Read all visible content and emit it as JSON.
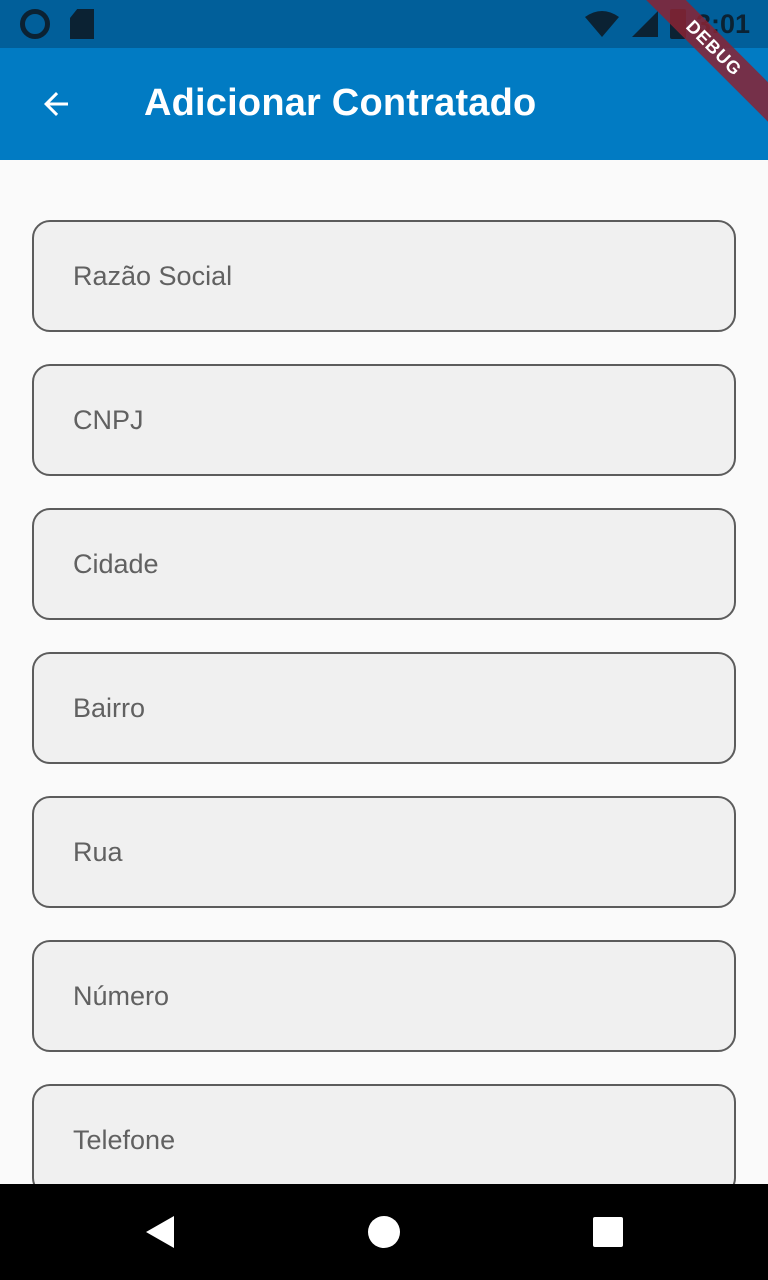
{
  "status_bar": {
    "time": "3:01",
    "icons": [
      "circle-icon",
      "sd-card-icon",
      "wifi-icon",
      "signal-icon",
      "battery-icon"
    ]
  },
  "app_bar": {
    "title": "Adicionar Contratado",
    "back_icon": "arrow-back-icon",
    "background": "#017bc3"
  },
  "debug_banner": {
    "label": "DEBUG"
  },
  "form": {
    "fields": [
      {
        "placeholder": "Razão Social",
        "value": ""
      },
      {
        "placeholder": "CNPJ",
        "value": ""
      },
      {
        "placeholder": "Cidade",
        "value": ""
      },
      {
        "placeholder": "Bairro",
        "value": ""
      },
      {
        "placeholder": "Rua",
        "value": ""
      },
      {
        "placeholder": "Número",
        "value": ""
      },
      {
        "placeholder": "Telefone",
        "value": ""
      }
    ]
  },
  "nav_bar": {
    "icons": [
      "nav-back-icon",
      "nav-home-icon",
      "nav-recent-apps-icon"
    ]
  }
}
